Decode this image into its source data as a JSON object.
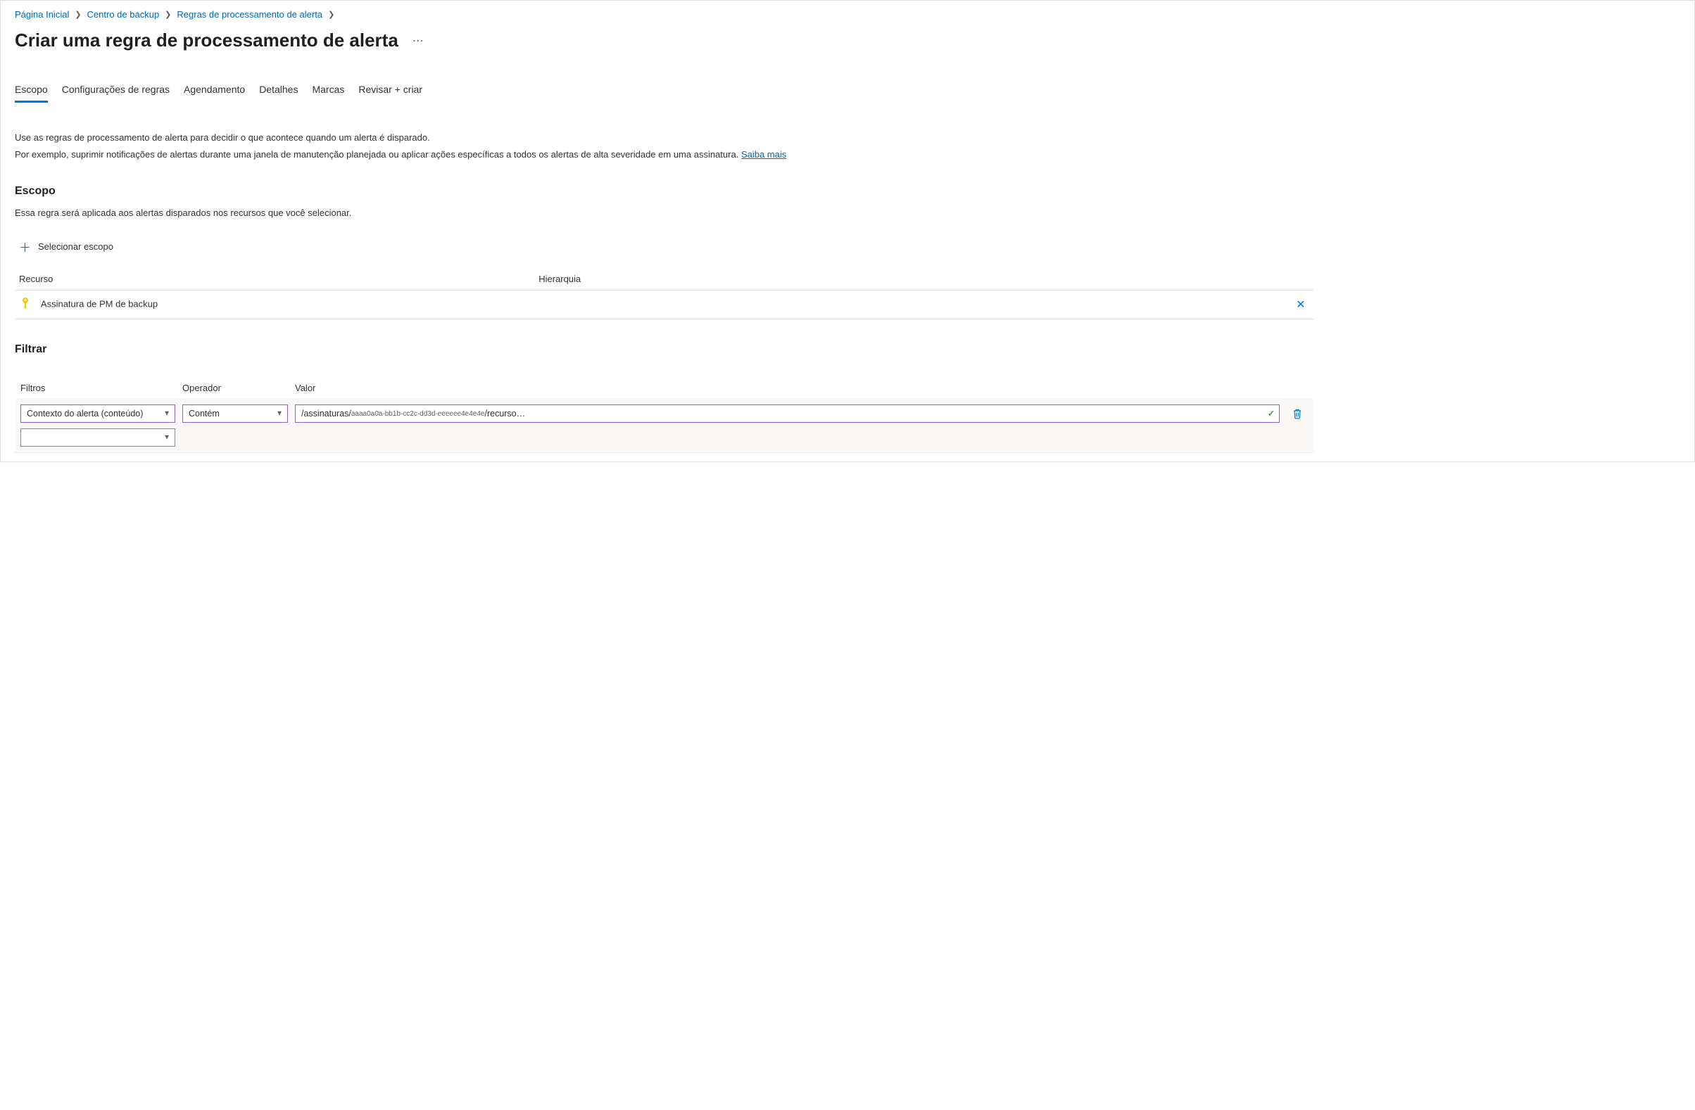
{
  "breadcrumb": {
    "home": "Página Inicial",
    "backup_center": "Centro de backup",
    "alert_rules": "Regras de processamento de alerta"
  },
  "page": {
    "title": "Criar uma regra de processamento de alerta"
  },
  "tabs": {
    "scope": "Escopo",
    "rule_settings": "Configurações de regras",
    "scheduling": "Agendamento",
    "details": "Detalhes",
    "tags": "Marcas",
    "review_create": "Revisar + criar"
  },
  "intro": {
    "line1": "Use as regras de processamento de alerta para decidir o que acontece quando um alerta é disparado.",
    "line2": "Por exemplo, suprimir notificações de alertas durante uma janela de manutenção planejada ou aplicar ações específicas a todos os alertas de alta severidade em uma assinatura. ",
    "learn_more": "Saiba mais"
  },
  "scope": {
    "title": "Escopo",
    "desc": "Essa regra será aplicada aos alertas disparados nos recursos que você selecionar.",
    "select_scope_label": "Selecionar escopo",
    "table": {
      "col_resource": "Recurso",
      "col_hierarchy": "Hierarquia",
      "row1_name": "Assinatura de PM de backup"
    }
  },
  "filter": {
    "title": "Filtrar",
    "col_filters": "Filtros",
    "col_operator": "Operador",
    "col_value": "Valor",
    "row1": {
      "filter": "Contexto do alerta (conteúdo)",
      "operator": "Contém",
      "value_prefix": "/assinaturas/",
      "value_guid": "aaaa0a0a-bb1b-cc2c-dd3d-eeeeee4e4e4e",
      "value_suffix": " /recurso…"
    },
    "row2": {
      "filter": ""
    }
  }
}
